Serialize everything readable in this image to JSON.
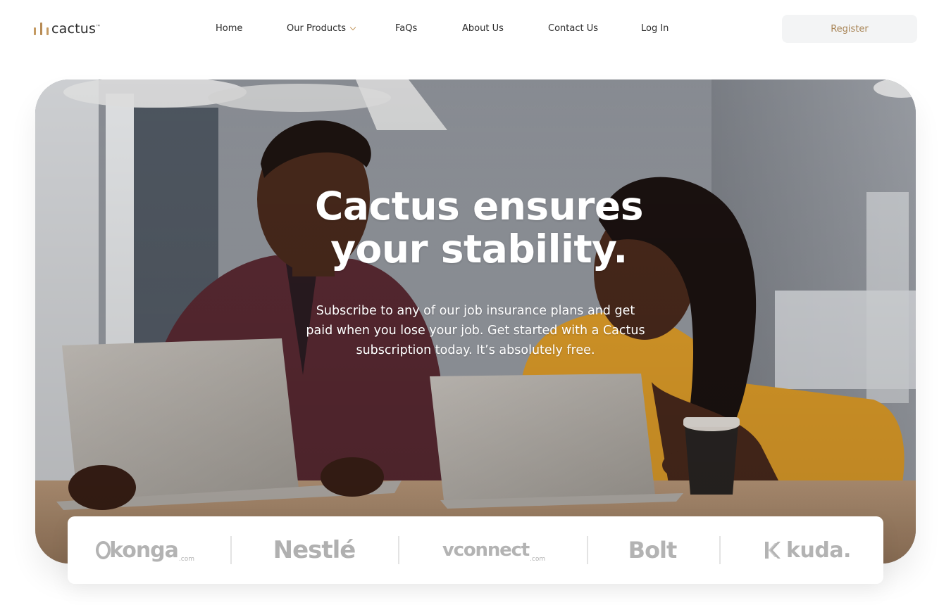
{
  "brand": {
    "name": "cactus",
    "trademark": "™",
    "accent_color": "#b78b55"
  },
  "nav": {
    "items": [
      {
        "label": "Home"
      },
      {
        "label": "Our Products",
        "has_dropdown": true
      },
      {
        "label": "FaQs"
      },
      {
        "label": "About Us"
      },
      {
        "label": "Contact Us"
      },
      {
        "label": "Log In"
      }
    ],
    "register_label": "Register"
  },
  "hero": {
    "title_line1": "Cactus ensures",
    "title_line2": "your stability.",
    "subtitle": "Subscribe to any of our job insurance plans and get paid when you lose your job. Get started with a Cactus subscription today. It’s absolutely free."
  },
  "partners": {
    "konga": {
      "name": "konga",
      "suffix": ".com"
    },
    "nestle": {
      "name": "Nestlé"
    },
    "vconnect": {
      "name": "vconnect",
      "suffix": ".com"
    },
    "bolt": {
      "name": "Bolt"
    },
    "kuda": {
      "name": "kuda."
    }
  }
}
